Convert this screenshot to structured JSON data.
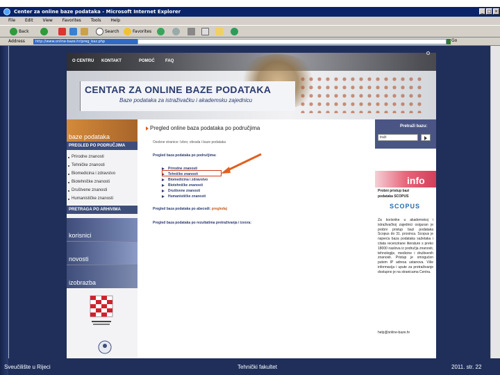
{
  "window": {
    "title": "Center za online baze podataka - Microsoft Internet Explorer"
  },
  "menu": [
    "File",
    "Edit",
    "View",
    "Favorites",
    "Tools",
    "Help"
  ],
  "toolbar": {
    "back_label": "Back",
    "search_label": "Search",
    "favorites_label": "Favorites"
  },
  "address": {
    "label": "Address",
    "url": "http://www.online-baze.hr/preg_baz.php",
    "go_label": "Go"
  },
  "nav": [
    "O CENTRU",
    "KONTAKT",
    "POMOĆ",
    "FAQ"
  ],
  "banner": {
    "title": "CENTAR ZA ONLINE BAZE PODATAKA",
    "subtitle": "Baze podataka za istraživačku i akademsku zajednicu"
  },
  "sidebar": {
    "baze_heading": "baze podataka",
    "list_title": "PREGLED PO PODRUČJIMA",
    "items": [
      "Prirodne znanosti",
      "Tehničke znanosti",
      "Biomedicina i zdravstvo",
      "Biotehničke znanosti",
      "Društvene znanosti",
      "Humanističke znanosti"
    ],
    "arhiv_title": "PRETRAGA PO ARHIVIMA",
    "sections": [
      "korisnici",
      "novosti",
      "izobrazba"
    ]
  },
  "main": {
    "heading": "Pregled online baza podataka po područjima",
    "breadcrumb": "Osobne stranice: Izbor, obrada i baze podataka",
    "area_label": "Pregled baza podataka po područjima:",
    "categories": [
      "Prirodne znanosti",
      "Tehničke znanosti",
      "Biomedicina i zdravstvo",
      "Biotehničke znanosti",
      "Društvene znanosti",
      "Humanističke znanosti"
    ],
    "alpha_label": "Pregled baza podataka po abecedi:",
    "alpha_link": "pregledaj",
    "results_label": "Pregled baza podataka po rezultatima pretraživanja i izvora:"
  },
  "right": {
    "search_label": "Pretraži bazu:",
    "search_value": "traži",
    "info_title": "info",
    "info_line1": "Probni pristup bazi",
    "info_line2": "podataka SCOPUS",
    "scopus_logo": "SCOPUS",
    "info_body": "Za korisnike u akademskoj i istraživačkoj zajednici osiguran je probni pristup bazi podataka Scopus do 31. prosinca. Scopus je najveća baza podataka sažetaka i citata recenzirane literature s preko 18000 naslova iz područja znanosti, tehnologije, medicine i društvenih znanosti. Pristup je omogućen putem IP adresa ustanova. Više informacija i upute za pretraživanje dostupno je na stranicama Centra.",
    "contact_line": "help@online-baze.hr"
  },
  "footer": {
    "left": "Sveučilište u Rijeci",
    "center": "Tehnički fakultet",
    "right": "2011.  str. 22"
  },
  "colors": {
    "highlight": "#d13b16",
    "accent_red": "#e06020",
    "stage_bg": "#1f2f5a"
  }
}
